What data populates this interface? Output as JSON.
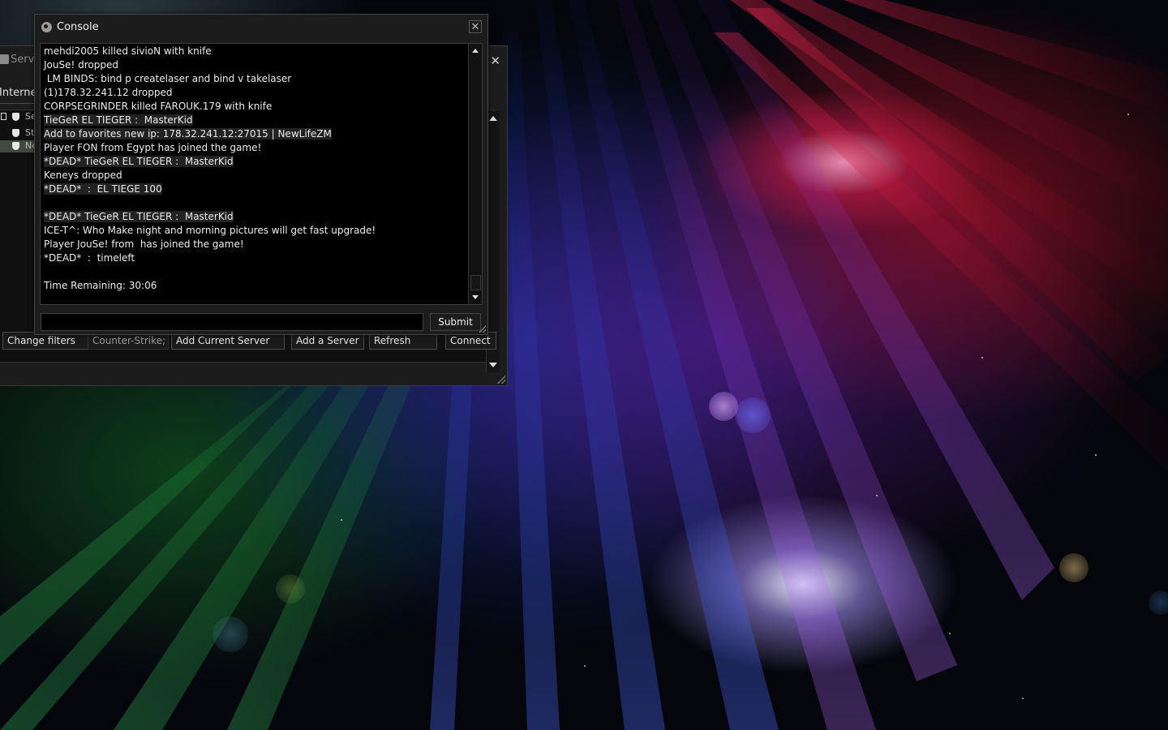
{
  "server_browser": {
    "title": "Servers",
    "tab_label": "Internet",
    "header_col": "Se",
    "rows": [
      {
        "label": "St"
      },
      {
        "label": "Ne"
      }
    ],
    "buttons": {
      "change_filters": "Change filters",
      "filter_value": "Counter-Strike;",
      "add_current": "Add Current Server",
      "add_server": "Add a Server",
      "refresh": "Refresh",
      "connect": "Connect"
    }
  },
  "console": {
    "title": "Console",
    "lines": [
      "mehdi2005 killed sivioN with knife",
      "JouSe! dropped",
      " LM BINDS: bind p createlaser and bind v takelaser",
      "(1)178.32.241.12 dropped",
      "CORPSEGRINDER killed FAROUK.179 with knife",
      "TieGeR EL TIEGER :  MasterKid",
      "Add to favorites new ip: 178.32.241.12:27015 | NewLifeZM",
      "Player FON from Egypt has joined the game!",
      "*DEAD* TieGeR EL TIEGER :  MasterKid",
      "Keneys dropped",
      "*DEAD*  :  EL TIEGE 100",
      "",
      "*DEAD* TieGeR EL TIEGER :  MasterKid",
      "ICE-T^: Who Make night and morning pictures will get fast upgrade!",
      "Player JouSe! from  has joined the game!",
      "*DEAD*  :  timeleft",
      "",
      "Time Remaining: 30:06"
    ],
    "input_value": "",
    "submit_label": "Submit"
  },
  "colors": {
    "window_bg": "#1c1c1c",
    "log_bg": "#000000",
    "text": "#ececec"
  },
  "icons": [
    "steam-icon",
    "console-icon",
    "close-icon",
    "shield-icon",
    "scroll-up-icon",
    "scroll-down-icon",
    "resize-grip-icon"
  ]
}
